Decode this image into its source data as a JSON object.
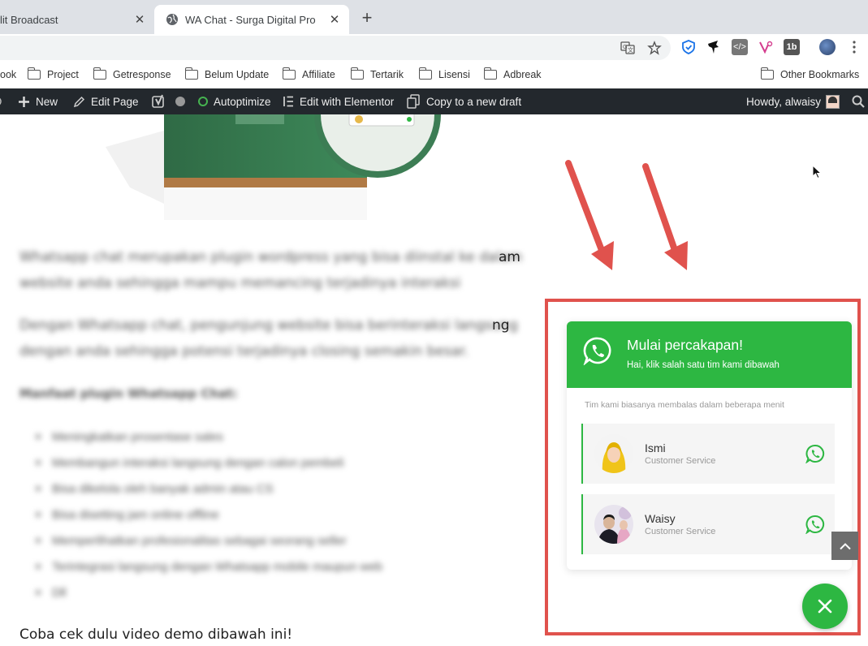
{
  "browser": {
    "tabs": [
      {
        "title": "lit Broadcast",
        "active": false
      },
      {
        "title": "WA Chat - Surga Digital Pro",
        "active": true
      }
    ],
    "new_tab_symbol": "+",
    "close_symbol": "✕"
  },
  "bookmarks": [
    {
      "label": "ook"
    },
    {
      "label": "Project"
    },
    {
      "label": "Getresponse"
    },
    {
      "label": "Belum Update"
    },
    {
      "label": "Affiliate"
    },
    {
      "label": "Tertarik"
    },
    {
      "label": "Lisensi"
    },
    {
      "label": "Adbreak"
    },
    {
      "label": "Other Bookmarks"
    }
  ],
  "admin_bar": {
    "new": "New",
    "edit_page": "Edit Page",
    "autoptimize": "Autoptimize",
    "elementor": "Edit with Elementor",
    "copy_draft": "Copy to a new draft",
    "howdy": "Howdy, alwaisy"
  },
  "content": {
    "para1_tail": "am",
    "para2_tail": "ng",
    "blur_para1_line1": "Whatsapp chat merupakan plugin wordpress yang bisa diinstal ke dalam",
    "blur_para1_line2": "website anda sehingga mampu memancing terjadinya interaksi",
    "blur_para2_line1": "Dengan Whatsapp chat, pengunjung website bisa berinteraksi langsung",
    "blur_para2_line2": "dengan anda sehingga potensi terjadinya closing semakin besar.",
    "blur_heading": "Manfaat plugin Whatsapp Chat:",
    "blur_bullets": [
      "Meningkatkan prosentase sales",
      "Membangun interaksi langsung dengan calon pembeli",
      "Bisa dikelola oleh banyak admin atau CS",
      "Bisa disetting jam online offline",
      "Memperlihatkan profesionalitas sebagai seorang seller",
      "Terintegrasi langsung dengan Whatsapp mobile maupun web",
      "Dll"
    ],
    "cta": "Coba cek dulu video demo dibawah ini!"
  },
  "wa_widget": {
    "title": "Mulai percakapan!",
    "subtitle": "Hai, klik salah satu tim kami dibawah",
    "note": "Tim kami biasanya membalas dalam beberapa menit",
    "agents": [
      {
        "name": "Ismi",
        "role": "Customer Service"
      },
      {
        "name": "Waisy",
        "role": "Customer Service"
      }
    ],
    "brand_color": "#2db742",
    "highlight_color": "#e0524d"
  }
}
